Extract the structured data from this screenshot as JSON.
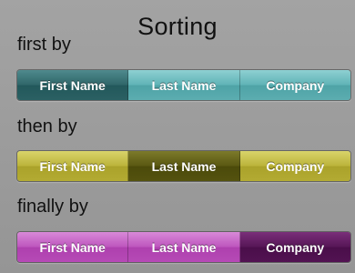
{
  "title": "Sorting",
  "controls": [
    {
      "label": "first by",
      "options": [
        "First Name",
        "Last Name",
        "Company"
      ],
      "selected": "First Name",
      "color": "#5fb3b6"
    },
    {
      "label": "then by",
      "options": [
        "First Name",
        "Last Name",
        "Company"
      ],
      "selected": "Last Name",
      "color": "#bbb33a"
    },
    {
      "label": "finally by",
      "options": [
        "First Name",
        "Last Name",
        "Company"
      ],
      "selected": "Company",
      "color": "#bd55bd"
    }
  ]
}
